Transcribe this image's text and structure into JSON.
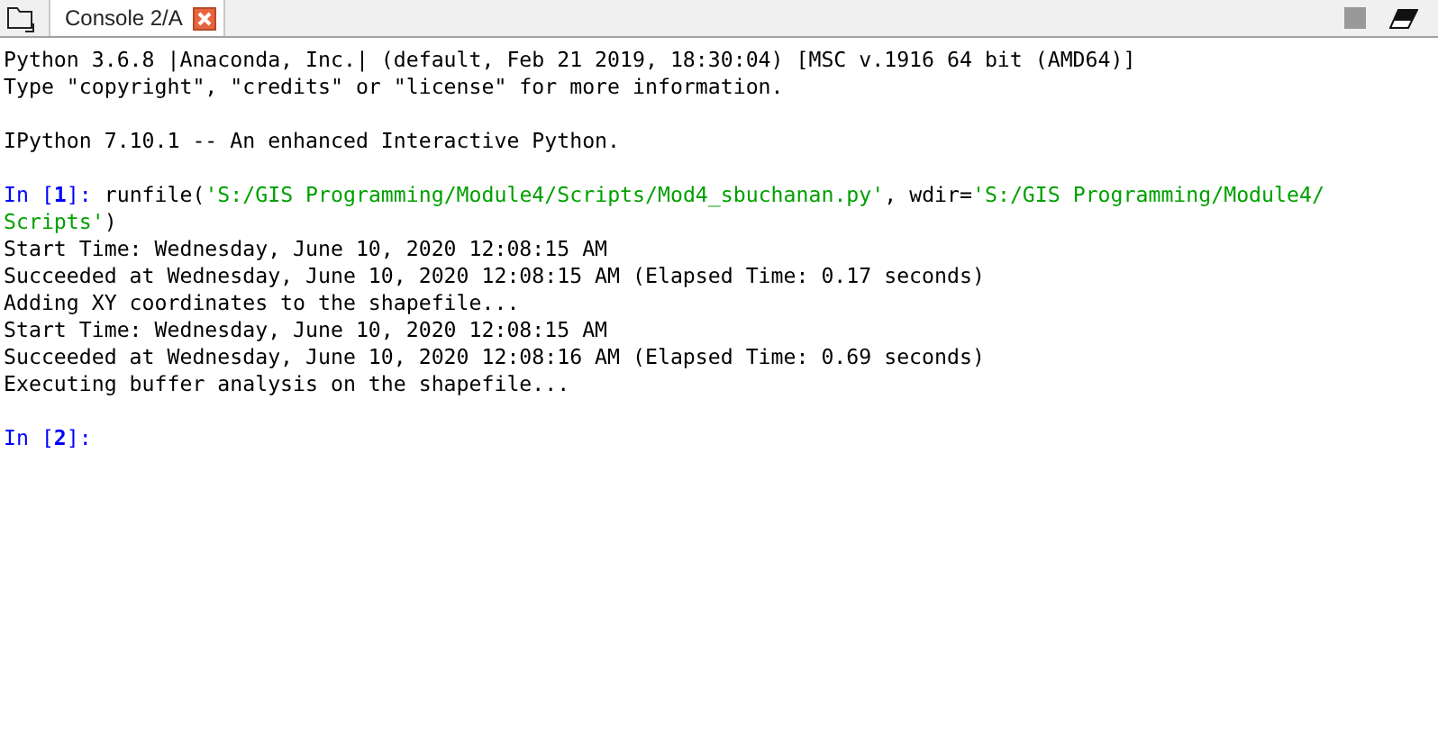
{
  "tab_bar": {
    "tabs": [
      {
        "label": "Console 2/A",
        "selected": true
      }
    ]
  },
  "console": {
    "blocks": [
      {
        "lines": [
          [
            {
              "kind": "out",
              "text": "Python 3.6.8 |Anaconda, Inc.| (default, Feb 21 2019, 18:30:04) [MSC v.1916 64 bit (AMD64)]"
            }
          ],
          [
            {
              "kind": "out",
              "text": "Type \"copyright\", \"credits\" or \"license\" for more information."
            }
          ]
        ]
      },
      {
        "lines": [
          [
            {
              "kind": "out",
              "text": "IPython 7.10.1 -- An enhanced Interactive Python."
            }
          ]
        ]
      },
      {
        "lines": [
          [
            {
              "kind": "prompt",
              "text": "In ["
            },
            {
              "kind": "prompt_num",
              "text": "1"
            },
            {
              "kind": "prompt",
              "text": "]: "
            },
            {
              "kind": "code",
              "text": "runfile("
            },
            {
              "kind": "string",
              "text": "'S:/GIS Programming/Module4/Scripts/Mod4_sbuchanan.py'"
            },
            {
              "kind": "code",
              "text": ", wdir="
            },
            {
              "kind": "string",
              "text": "'S:/GIS Programming/Module4/"
            }
          ],
          [
            {
              "kind": "string",
              "text": "Scripts'"
            },
            {
              "kind": "code",
              "text": ")"
            }
          ],
          [
            {
              "kind": "out",
              "text": "Start Time: Wednesday, June 10, 2020 12:08:15 AM"
            }
          ],
          [
            {
              "kind": "out",
              "text": "Succeeded at Wednesday, June 10, 2020 12:08:15 AM (Elapsed Time: 0.17 seconds)"
            }
          ],
          [
            {
              "kind": "out",
              "text": "Adding XY coordinates to the shapefile..."
            }
          ],
          [
            {
              "kind": "out",
              "text": "Start Time: Wednesday, June 10, 2020 12:08:15 AM"
            }
          ],
          [
            {
              "kind": "out",
              "text": "Succeeded at Wednesday, June 10, 2020 12:08:16 AM (Elapsed Time: 0.69 seconds)"
            }
          ],
          [
            {
              "kind": "out",
              "text": "Executing buffer analysis on the shapefile..."
            }
          ]
        ]
      },
      {
        "lines": [
          [
            {
              "kind": "prompt",
              "text": "In ["
            },
            {
              "kind": "prompt_num",
              "text": "2"
            },
            {
              "kind": "prompt",
              "text": "]: "
            }
          ]
        ]
      }
    ]
  }
}
